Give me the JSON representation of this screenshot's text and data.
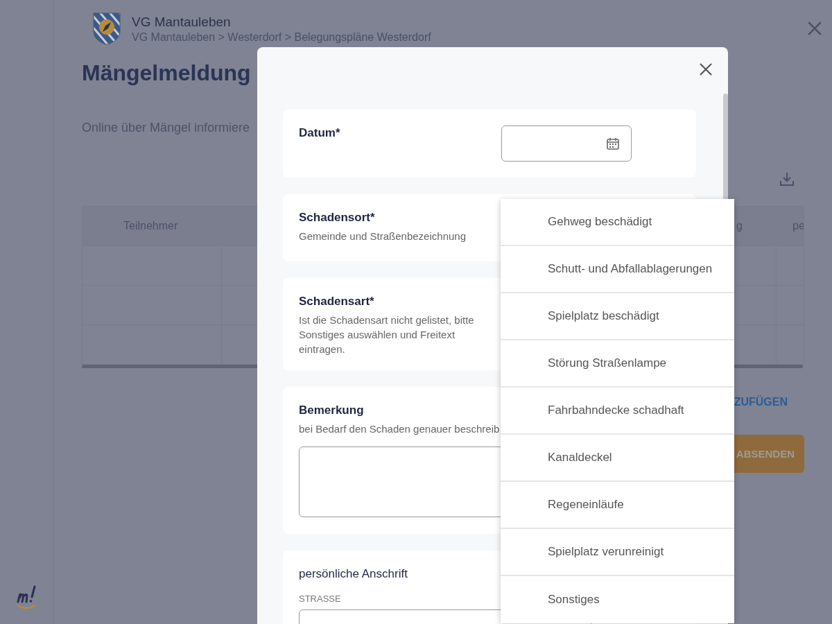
{
  "header": {
    "org": "VG Mantauleben",
    "breadcrumb": "VG Mantauleben > Westerdorf > Belegungspläne Westerdorf"
  },
  "page": {
    "title": "Mängelmeldung",
    "subtitle": "Online über Mängel informiere"
  },
  "table": {
    "columns": [
      {
        "label": "Teilnehmer"
      },
      {
        "label": "g"
      },
      {
        "label": "pe"
      }
    ]
  },
  "add_link": "ZUFÜGEN",
  "submit_button": "ABSENDEN",
  "dialog": {
    "fields": [
      {
        "kind": "date",
        "label": "Datum*"
      },
      {
        "kind": "select",
        "label": "Schadensort*",
        "hint": "Gemeinde und Straßenbezeichnung"
      },
      {
        "kind": "select",
        "label": "Schadensart*",
        "hint": "Ist die Schadensart nicht gelistet, bitte Sonstiges auswählen und Freitext eintragen."
      },
      {
        "kind": "textarea",
        "label": "Bemerkung",
        "hint": "bei Bedarf den Schaden genauer beschreib"
      },
      {
        "kind": "address",
        "label": "persönliche Anschrift",
        "sublabel": "STRASSE"
      }
    ]
  },
  "dropdown": {
    "options": [
      {
        "label": "Gehweg beschädigt",
        "selected": false
      },
      {
        "label": "Schutt- und Abfallablagerungen",
        "selected": false
      },
      {
        "label": "Spielplatz beschädigt",
        "selected": false
      },
      {
        "label": "Störung Straßenlampe",
        "selected": false
      },
      {
        "label": "Fahrbahndecke schadhaft",
        "selected": false
      },
      {
        "label": "Kanaldeckel",
        "selected": false
      },
      {
        "label": "Regeneinläufe",
        "selected": false
      },
      {
        "label": "Spielplatz verunreinigt",
        "selected": false
      },
      {
        "label": "Sonstiges",
        "selected": false
      }
    ]
  }
}
